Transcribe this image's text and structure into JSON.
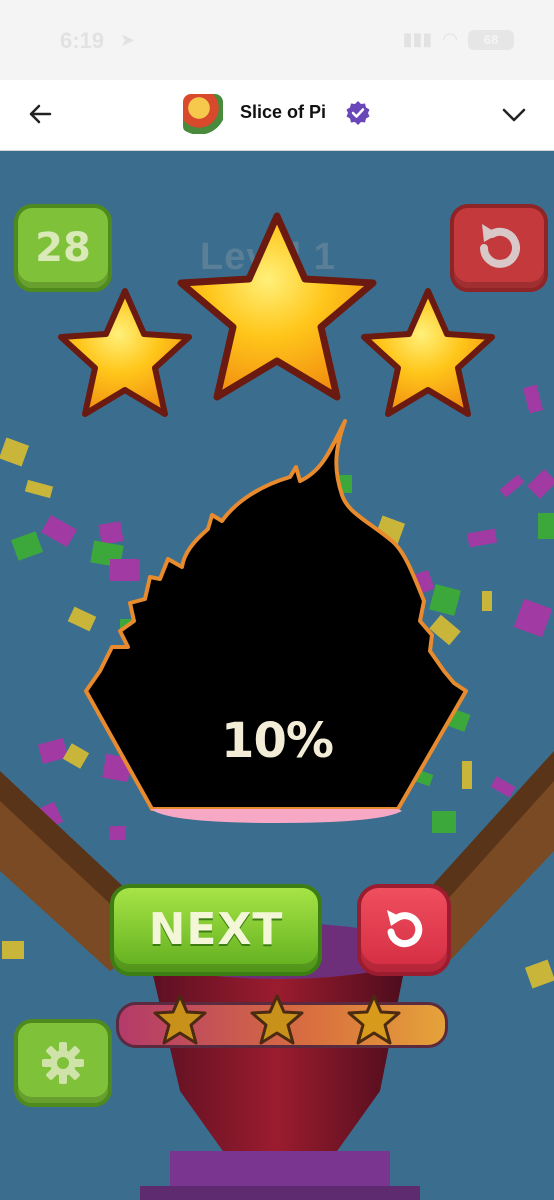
{
  "status_bar": {
    "time": "6:19",
    "battery": "68"
  },
  "header": {
    "title": "Slice of Pi"
  },
  "game": {
    "level_count": "28",
    "level_label": "Level 1",
    "percent": "10%",
    "next_label": "NEXT",
    "stars_earned": 3,
    "progress_stars": 3
  },
  "colors": {
    "green_button": "#7fc23a",
    "red_button": "#c43a3c",
    "background": "#3b6e8e",
    "star": "#ffc61a"
  }
}
